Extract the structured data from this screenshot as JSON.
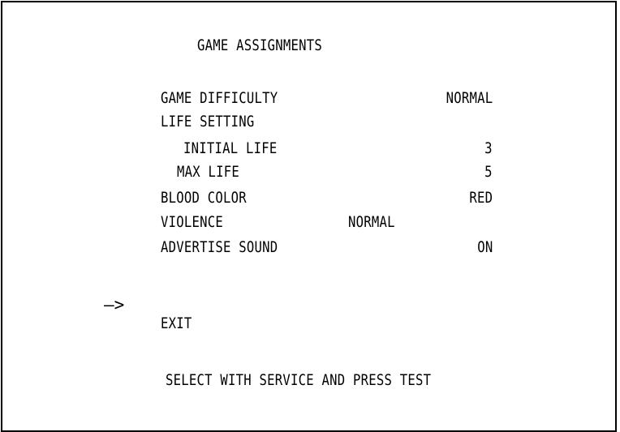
{
  "screen": {
    "title": "GAME ASSIGNMENTS",
    "items": [
      {
        "label": "GAME DIFFICULTY",
        "value": "NORMAL"
      },
      {
        "label": "LIFE SETTING",
        "value": ""
      },
      {
        "label": "INITIAL LIFE",
        "value": "3"
      },
      {
        "label": "MAX LIFE",
        "value": "5"
      },
      {
        "label": "BLOOD COLOR",
        "value": "RED"
      },
      {
        "label": "VIOLENCE",
        "value": "NORMAL"
      },
      {
        "label": "ADVERTISE SOUND",
        "value": "ON"
      }
    ],
    "cursor": "—>",
    "exit_label": "EXIT",
    "footer": "SELECT WITH SERVICE AND PRESS TEST"
  }
}
